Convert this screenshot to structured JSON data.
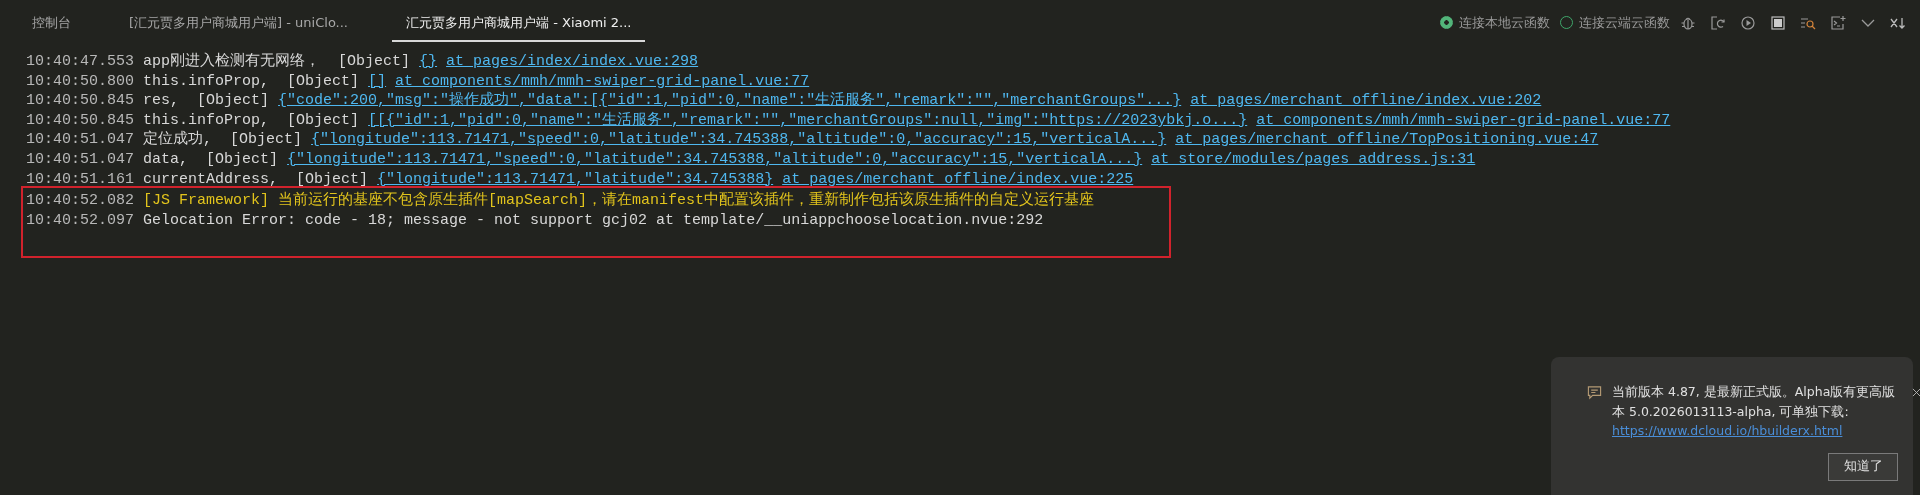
{
  "tabs": [
    {
      "label": "控制台",
      "selected": false
    },
    {
      "label": "[汇元贾多用户商城用户端] - uniClo...",
      "selected": false
    },
    {
      "label": "汇元贾多用户商城用户端 - Xiaomi 2...",
      "selected": true
    }
  ],
  "connections": [
    {
      "label": "连接本地云函数",
      "selected": true
    },
    {
      "label": "连接云端云函数",
      "selected": false
    }
  ],
  "toolbar_icons": [
    {
      "kind": "bug"
    },
    {
      "kind": "reload"
    },
    {
      "kind": "play"
    },
    {
      "kind": "stop"
    },
    {
      "kind": "find"
    },
    {
      "kind": "terminal"
    },
    {
      "kind": "chevron"
    },
    {
      "kind": "clear"
    }
  ],
  "log": [
    {
      "time": "10:40:47.553",
      "message": "app刚进入检测有无网络，",
      "object": "[Object]",
      "value": "{}",
      "location": "at pages/index/index.vue:298"
    },
    {
      "time": "10:40:50.800",
      "message": "this.infoProp,",
      "object": "[Object]",
      "value": "[]",
      "location": "at components/mmh/mmh-swiper-grid-panel.vue:77"
    },
    {
      "time": "10:40:50.845",
      "message": "res,",
      "object": "[Object]",
      "value": "{\"code\":200,\"msg\":\"操作成功\",\"data\":[{\"id\":1,\"pid\":0,\"name\":\"生活服务\",\"remark\":\"\",\"merchantGroups\"...}",
      "location": "at pages/merchant_offline/index.vue:202"
    },
    {
      "time": "10:40:50.845",
      "message": "this.infoProp,",
      "object": "[Object]",
      "value": "[[{\"id\":1,\"pid\":0,\"name\":\"生活服务\",\"remark\":\"\",\"merchantGroups\":null,\"img\":\"https://2023ybkj.o...}",
      "location": "at components/mmh/mmh-swiper-grid-panel.vue:77"
    },
    {
      "time": "10:40:51.047",
      "message": "定位成功,",
      "object": "[Object]",
      "value": "{\"longitude\":113.71471,\"speed\":0,\"latitude\":34.745388,\"altitude\":0,\"accuracy\":15,\"verticalA...}",
      "location": "at pages/merchant_offline/TopPositioning.vue:47"
    },
    {
      "time": "10:40:51.047",
      "message": "data,",
      "object": "[Object]",
      "value": "{\"longitude\":113.71471,\"speed\":0,\"latitude\":34.745388,\"altitude\":0,\"accuracy\":15,\"verticalA...}",
      "location": "at store/modules/pages_address.js:31"
    },
    {
      "time": "10:40:51.161",
      "message": "currentAddress,",
      "object": "[Object]",
      "value": "{\"longitude\":113.71471,\"latitude\":34.745388}",
      "location": "at pages/merchant_offline/index.vue:225"
    }
  ],
  "highlighted_log": [
    {
      "time": "10:40:52.082",
      "kind": "warning",
      "message": "[JS Framework] 当前运行的基座不包含原生插件[mapSearch]，请在manifest中配置该插件，重新制作包括该原生插件的自定义运行基座"
    },
    {
      "time": "10:40:52.097",
      "kind": "plain",
      "message": "Gelocation Error: code - 18; message - not support gcj02 at template/__uniappchooselocation.nvue:292"
    }
  ],
  "notification": {
    "text": "当前版本 4.87, 是最新正式版。Alpha版有更高版本 5.0.2026013113-alpha, 可单独下载:",
    "link": "https://www.dcloud.io/hbuilderx.html",
    "button": "知道了"
  }
}
